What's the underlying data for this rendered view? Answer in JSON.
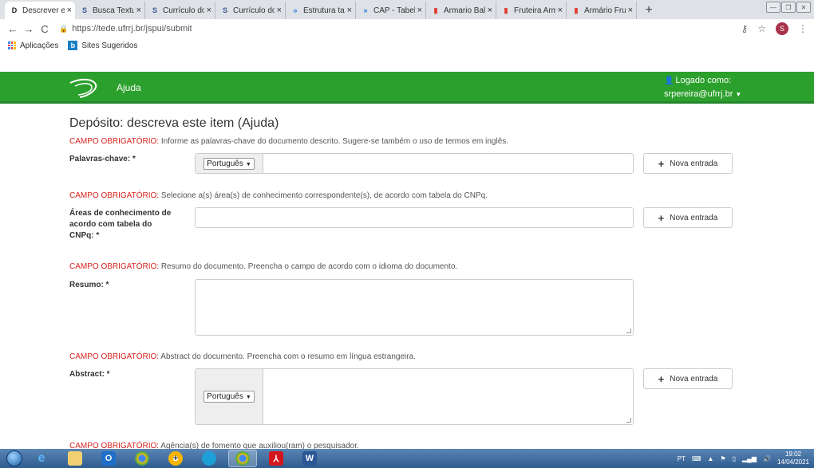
{
  "browser": {
    "tabs": [
      {
        "title": "Descrever es",
        "favicon": "D",
        "favicon_color": "#222",
        "active": true
      },
      {
        "title": "Busca Textu",
        "favicon": "S",
        "favicon_color": "#3b5998",
        "active": false
      },
      {
        "title": "Currículo do",
        "favicon": "S",
        "favicon_color": "#3b5998",
        "active": false
      },
      {
        "title": "Currículo do",
        "favicon": "S",
        "favicon_color": "#3b5998",
        "active": false
      },
      {
        "title": "Estrutura ta",
        "favicon": "»",
        "favicon_color": "#1a73e8",
        "active": false
      },
      {
        "title": "CAP - Tabel",
        "favicon": "»",
        "favicon_color": "#1a73e8",
        "active": false
      },
      {
        "title": "Armario Bal",
        "favicon": "▮",
        "favicon_color": "#e03c31",
        "active": false
      },
      {
        "title": "Fruteira Arm",
        "favicon": "▮",
        "favicon_color": "#e03c31",
        "active": false
      },
      {
        "title": "Armário Fru",
        "favicon": "▮",
        "favicon_color": "#e03c31",
        "active": false
      }
    ],
    "new_tab": "+",
    "url": "https://tede.ufrrj.br/jspui/submit",
    "profile_initial": "S",
    "bookmarks": {
      "apps": "Aplicações",
      "sites": "Sites Sugeridos"
    }
  },
  "header": {
    "ajuda": "Ajuda",
    "logged_as": "Logado como:",
    "user": "srpereira@ufrrj.br"
  },
  "form": {
    "title": "Depósito: descreva este item (Ajuda)",
    "required_prefix": "CAMPO OBRIGATÓRIO:",
    "fields": [
      {
        "hint": "Informe as palavras-chave do documento descrito. Sugere-se também o uso de termos em inglês.",
        "label": "Palavras-chave: *",
        "language": "Português",
        "button": "Nova entrada"
      },
      {
        "hint": "Selecione a(s) área(s) de conhecimento correspondente(s), de acordo com tabela do CNPq.",
        "label": "Áreas de conhecimento de acordo com tabela do CNPq: *",
        "button": "Nova entrada"
      },
      {
        "hint": "Resumo do documento. Preencha o campo de acordo com o idioma do documento.",
        "label": "Resumo: *"
      },
      {
        "hint": "Abstract do documento. Preencha com o resumo em língua estrangeira.",
        "label": "Abstract: *",
        "language": "Português",
        "button": "Nova entrada"
      },
      {
        "hint": "Agência(s) de fomento que auxiliou(ram) o pesquisador."
      }
    ]
  },
  "taskbar": {
    "lang": "PT",
    "time": "19:02",
    "date": "14/04/2021"
  }
}
